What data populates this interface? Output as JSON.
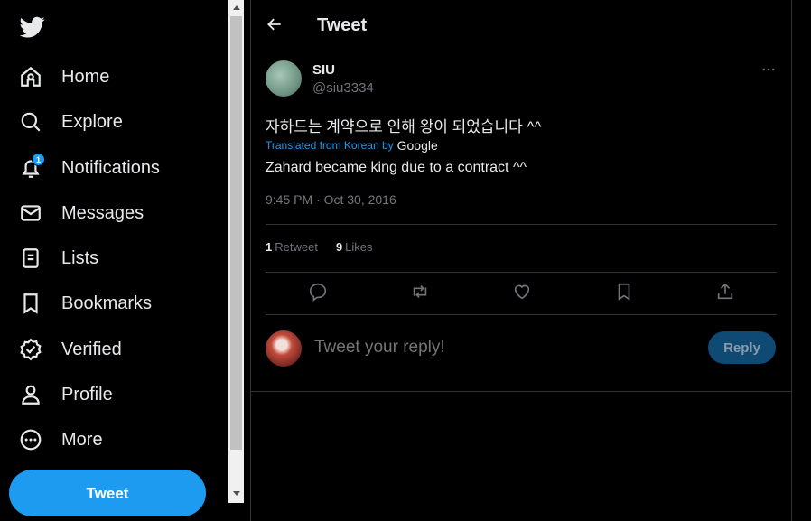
{
  "sidebar": {
    "logo": "twitter-bird-icon",
    "items": [
      {
        "label": "Home",
        "icon": "home-icon"
      },
      {
        "label": "Explore",
        "icon": "search-icon"
      },
      {
        "label": "Notifications",
        "icon": "bell-icon",
        "badge": "1"
      },
      {
        "label": "Messages",
        "icon": "envelope-icon"
      },
      {
        "label": "Lists",
        "icon": "list-icon"
      },
      {
        "label": "Bookmarks",
        "icon": "bookmark-icon"
      },
      {
        "label": "Verified",
        "icon": "verified-icon"
      },
      {
        "label": "Profile",
        "icon": "person-icon"
      },
      {
        "label": "More",
        "icon": "more-circle-icon"
      }
    ],
    "tweet_button": "Tweet"
  },
  "header": {
    "title": "Tweet"
  },
  "tweet": {
    "author_name": "SIU",
    "author_handle": "@siu3334",
    "text": "자하드는 계약으로 인해 왕이 되었습니다 ^^",
    "translated_label": "Translated from Korean by",
    "translator": "Google",
    "translated_text": "Zahard became king due to a contract ^^",
    "timestamp": "9:45 PM · Oct 30, 2016",
    "retweets": "1",
    "retweets_label": "Retweet",
    "likes": "9",
    "likes_label": "Likes"
  },
  "reply": {
    "placeholder": "Tweet your reply!",
    "button": "Reply"
  },
  "colors": {
    "accent": "#1d9bf0",
    "background": "#000000",
    "muted_text": "#71767b",
    "border": "#2f3336"
  }
}
